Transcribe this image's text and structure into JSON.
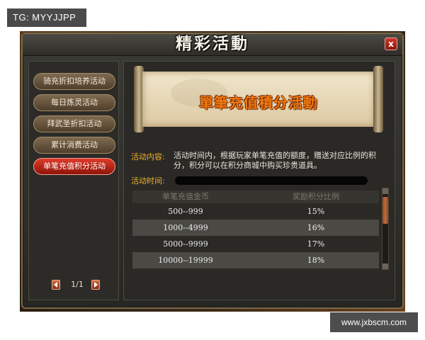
{
  "watermark_top": "TG: MYYJJPP",
  "watermark_bottom": "www.jxbscm.com",
  "window": {
    "title": "精彩活動",
    "close_label": "x"
  },
  "sidebar": {
    "items": [
      {
        "label": "骑充折扣培养活动",
        "active": false
      },
      {
        "label": "每日炼灵活动",
        "active": false
      },
      {
        "label": "拜武圣折扣活动",
        "active": false
      },
      {
        "label": "累计消费活动",
        "active": false
      },
      {
        "label": "单笔充值积分活动",
        "active": true
      }
    ],
    "pager": {
      "text": "1/1"
    }
  },
  "banner": {
    "title": "單筆充值積分活動"
  },
  "info": {
    "content_label": "活动内容:",
    "content_text": "活动时间内，根据玩家单笔充值的额度，赠送对应比例的积分，积分可以在积分商城中购买珍贵道具。",
    "time_label": "活动时间:"
  },
  "table": {
    "headers": [
      "单笔充值金币",
      "奖励积分比例"
    ],
    "rows": [
      [
        "500--999",
        "15%"
      ],
      [
        "1000--4999",
        "16%"
      ],
      [
        "5000--9999",
        "17%"
      ],
      [
        "10000--19999",
        "18%"
      ]
    ]
  },
  "colors": {
    "accent_active": "#d0301f",
    "label_gold": "#f2b128",
    "banner_title": "#f07a10"
  }
}
